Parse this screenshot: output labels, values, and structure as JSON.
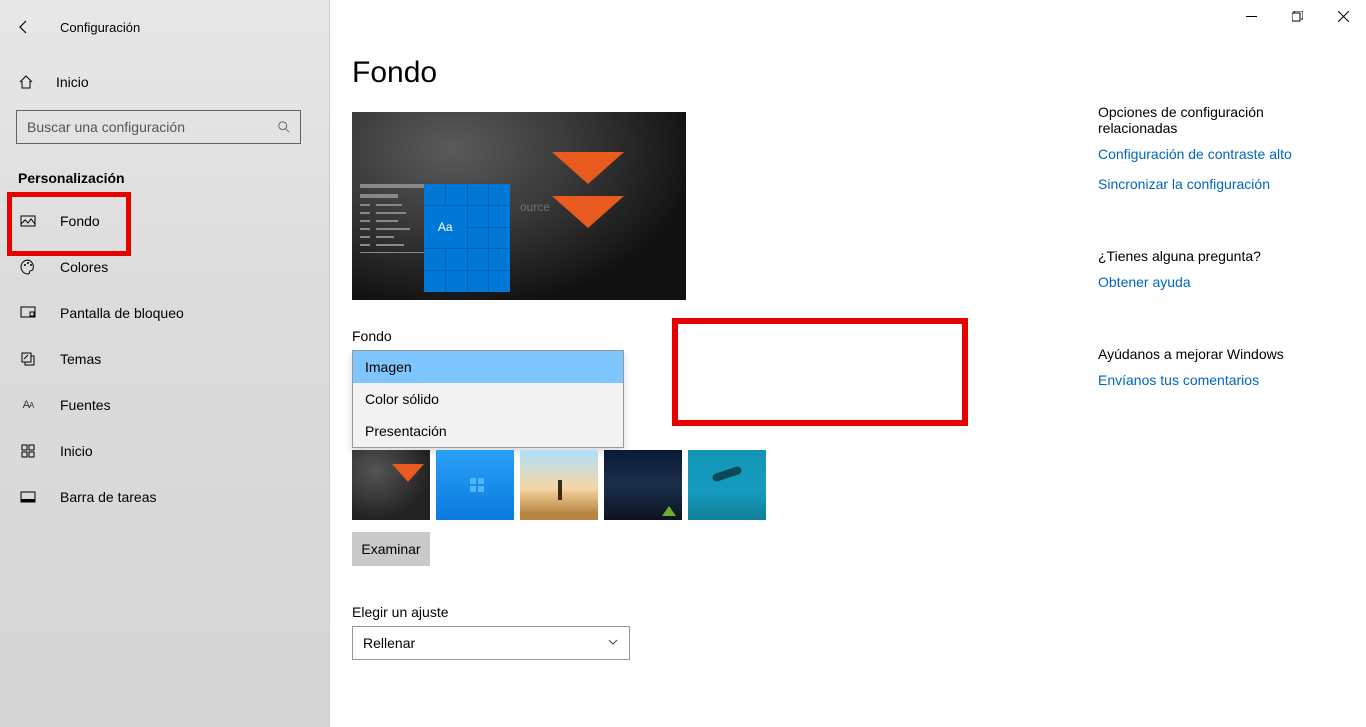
{
  "app_title": "Configuración",
  "sidebar": {
    "home_label": "Inicio",
    "search_placeholder": "Buscar una configuración",
    "section_title": "Personalización",
    "items": [
      {
        "label": "Fondo"
      },
      {
        "label": "Colores"
      },
      {
        "label": "Pantalla de bloqueo"
      },
      {
        "label": "Temas"
      },
      {
        "label": "Fuentes"
      },
      {
        "label": "Inicio"
      },
      {
        "label": "Barra de tareas"
      }
    ]
  },
  "main": {
    "heading": "Fondo",
    "preview_tile_text": "Aa",
    "background_type": {
      "label": "Fondo",
      "options": [
        "Imagen",
        "Color sólido",
        "Presentación"
      ],
      "selected_index": 0
    },
    "browse_button": "Examinar",
    "fit": {
      "label": "Elegir un ajuste",
      "value": "Rellenar"
    }
  },
  "rail": {
    "related_heading_line1": "Opciones de configuración",
    "related_heading_line2": "relacionadas",
    "link_contrast": "Configuración de contraste alto",
    "link_sync": "Sincronizar la configuración",
    "question_heading": "¿Tienes alguna pregunta?",
    "link_help": "Obtener ayuda",
    "improve_heading": "Ayúdanos a mejorar Windows",
    "link_feedback": "Envíanos tus comentarios"
  }
}
